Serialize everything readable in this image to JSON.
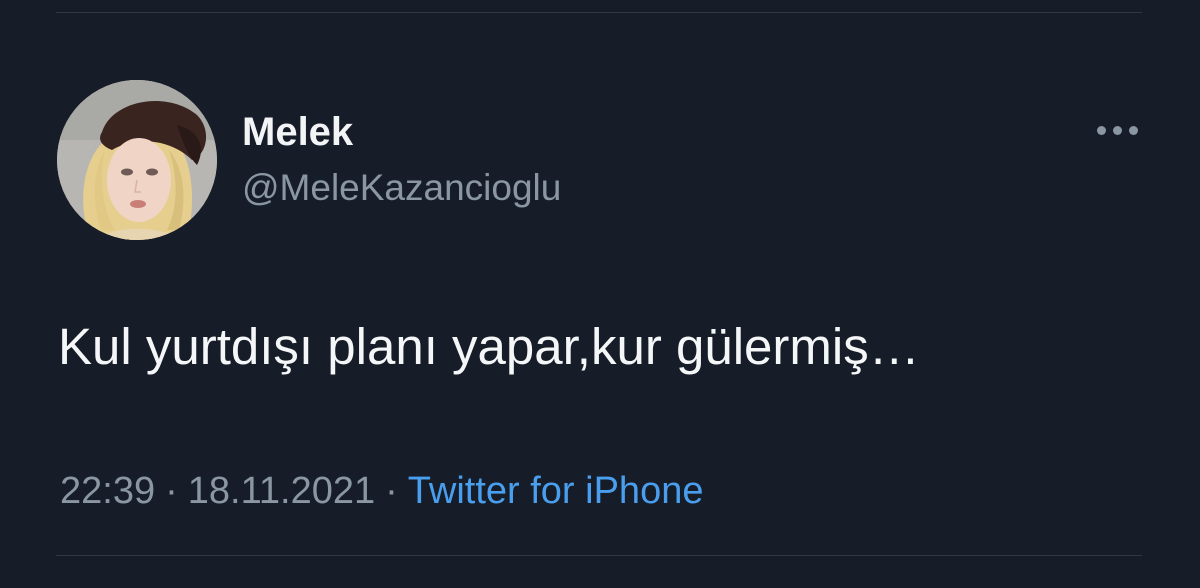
{
  "tweet": {
    "display_name": "Melek",
    "handle": "@MeleKazancioglu",
    "text": "Kul yurtdışı planı yapar,kur gülermiş…",
    "time": "22:39",
    "separator": "·",
    "date": "18.11.2021",
    "source": "Twitter for iPhone",
    "more_icon": "ellipsis-icon"
  },
  "colors": {
    "background": "#161d28",
    "primary_text": "#f4f6f7",
    "secondary_text": "#8a97a3",
    "link": "#4a9eee",
    "divider": "#2f3944"
  }
}
